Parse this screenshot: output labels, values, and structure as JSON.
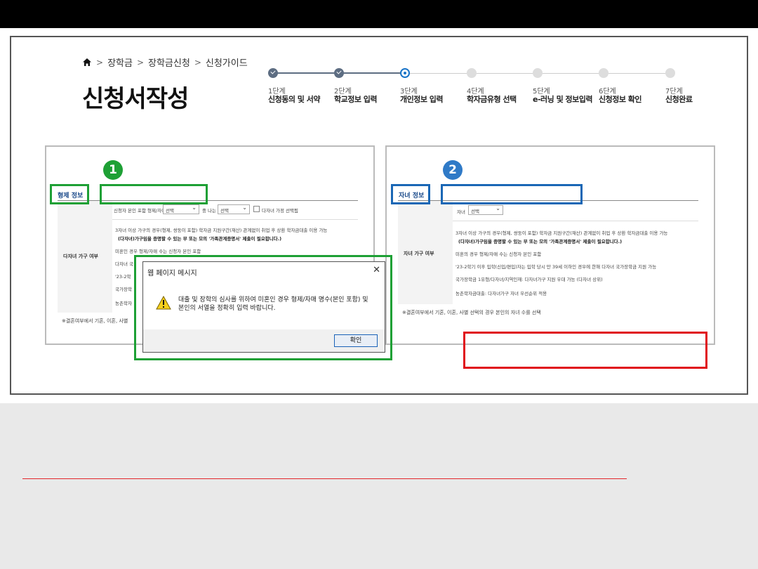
{
  "breadcrumb": {
    "items": [
      "장학금",
      "장학금신청",
      "신청가이드"
    ]
  },
  "page_title": "신청서작성",
  "steps": [
    {
      "num": "1단계",
      "name": "신청동의 및 서약",
      "state": "done"
    },
    {
      "num": "2단계",
      "name": "학교정보 입력",
      "state": "done"
    },
    {
      "num": "3단계",
      "name": "개인정보 입력",
      "state": "current"
    },
    {
      "num": "4단계",
      "name": "학자금유형 선택",
      "state": "todo"
    },
    {
      "num": "5단계",
      "name": "e-러닝 및 정보입력",
      "state": "todo"
    },
    {
      "num": "6단계",
      "name": "신청정보 확인",
      "state": "todo"
    },
    {
      "num": "7단계",
      "name": "신청완료",
      "state": "todo"
    }
  ],
  "left_panel": {
    "badge": "1",
    "section_label": "형제 정보",
    "row_label": "다자녀 가구 여부",
    "top_row": {
      "label1": "신청자 본인 포함 형제/자매",
      "select1": "선택",
      "label2": "중 나는",
      "select2": "선택",
      "checkbox_label": "다자녀 가정 선택됨"
    },
    "notes": [
      "3자녀 이상 가구의 경우(형제, 쌍둥이 포함) 학자금 지원구간(재산) 관계없이 취업 후 상환 학자금대출 이용 가능",
      "(다자녀)가구임을 증명할 수 있는 부 또는 모의 '가족관계증명서' 제출이 필요합니다.)",
      "미혼인 경우 형제/자매 수는 신청자 본인 포함",
      "다자녀 국",
      "'23-2학",
      "국가장학",
      "농촌학자"
    ],
    "footnote": "※결혼여부에서 기혼, 이혼, 사별"
  },
  "right_panel": {
    "badge": "2",
    "section_label": "자녀 정보",
    "row_label": "자녀 가구 여부",
    "top_row": {
      "label1": "자녀",
      "select1": "선택"
    },
    "notes": [
      "3자녀 이상 가구의 경우(형제, 쌍둥이 포함) 학자금 지원구간(재산) 관계없이 취업 후 상환 학자금대출 이용 가능",
      "(다자녀)가구임을 증명할 수 있는 부 또는 모의 '가족관계증명서' 제출이 필요합니다.)",
      "미혼의 경우 형제/자매 수는 신청자 본인 포함",
      "'23-2학기 이후 입학(신입/편입)자는 입학 당시 만 39세 이하인 경우에 한해 다자녀 국가장학금 지원 가능",
      "국가장학금 1유형/다자녀/지역인재: 다자녀가구 지원 우대 가능 (다자녀 상위)",
      "농촌학자금대출: 다자녀가구 자녀 우선순위 적용"
    ],
    "footnote": "※결혼여부에서 기혼, 이혼, 사별 선택의 경우 본인의 자녀 수를 선택"
  },
  "dialog": {
    "title": "웹 페이지 메시지",
    "message": "대출 및 장학의 심사를 위하여 미혼인 경우 형제/자매 명수(본인 포함) 및 본인의 서열을 정확히 입력 바랍니다.",
    "ok_label": "확인"
  },
  "colors": {
    "highlight_green": "#1ea035",
    "highlight_blue": "#1a67b5",
    "highlight_red": "#e0101a",
    "step_done": "#5d6d82",
    "step_current": "#1a74c8"
  }
}
